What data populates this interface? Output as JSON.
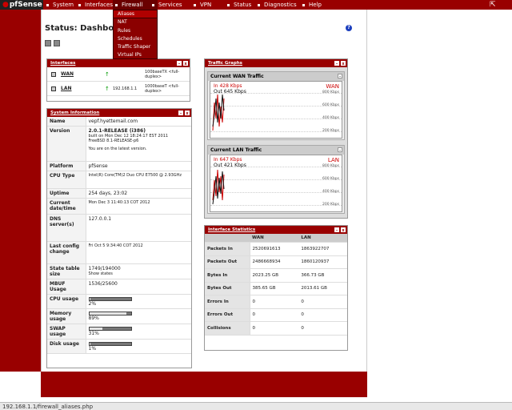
{
  "nav": {
    "logo": "pfSense",
    "items": [
      {
        "label": "System"
      },
      {
        "label": "Interfaces"
      },
      {
        "label": "Firewall"
      },
      {
        "label": "Services"
      },
      {
        "label": "VPN"
      },
      {
        "label": "Status"
      },
      {
        "label": "Diagnostics"
      },
      {
        "label": "Help"
      }
    ],
    "firewall_menu": [
      "Aliases",
      "NAT",
      "Rules",
      "Schedules",
      "Traffic Shaper",
      "Virtual IPs"
    ]
  },
  "page": {
    "title": "Status: Dashboard"
  },
  "interfaces": {
    "title": "Interfaces",
    "rows": [
      {
        "name": "WAN",
        "ip": "",
        "media": "100baseTX <full-duplex>"
      },
      {
        "name": "LAN",
        "ip": "192.168.1.1",
        "media": "1000baseT <full-duplex>"
      }
    ]
  },
  "sysinfo": {
    "title": "System Information",
    "name_label": "Name",
    "name": "vepf.hyettemail.com",
    "version_label": "Version",
    "version": "2.0.1-RELEASE (i386)",
    "version_built": "built on Mon Dec 12 18:24:17 EST 2011",
    "version_os": "FreeBSD 8.1-RELEASE-p6",
    "version_latest": "You are on the latest version.",
    "platform_label": "Platform",
    "platform": "pfSense",
    "cpu_type_label": "CPU Type",
    "cpu_type": "Intel(R) Core(TM)2 Duo CPU E7500 @ 2.93GHz",
    "uptime_label": "Uptime",
    "uptime": "254 days, 23:02",
    "datetime_label": "Current date/time",
    "datetime": "Mon Dec 3 11:40:13 COT 2012",
    "dns_label": "DNS server(s)",
    "dns": "127.0.0.1",
    "lastchange_label": "Last config change",
    "lastchange": "Fri Oct 5 9:34:40 COT 2012",
    "state_label": "State table size",
    "state": "1749/194000",
    "state_link": "Show states",
    "mbuf_label": "MBUF Usage",
    "mbuf": "1536/25600",
    "cpu_label": "CPU usage",
    "cpu": "2%",
    "cpu_pct": 2,
    "memory_label": "Memory usage",
    "memory": "89%",
    "memory_pct": 89,
    "swap_label": "SWAP usage",
    "swap": "31%",
    "swap_pct": 31,
    "disk_label": "Disk usage",
    "disk": "1%",
    "disk_pct": 1
  },
  "traffic": {
    "title": "Traffic Graphs",
    "wan": {
      "title": "Current WAN Traffic",
      "in": "In   428 Kbps",
      "out": "Out 645 Kbps",
      "tag": "WAN",
      "y": [
        "800 Kbps",
        "600 Kbps",
        "400 Kbps",
        "200 Kbps"
      ]
    },
    "lan": {
      "title": "Current LAN Traffic",
      "in": "In   647 Kbps",
      "out": "Out 421 Kbps",
      "tag": "LAN",
      "y": [
        "800 Kbps",
        "600 Kbps",
        "400 Kbps",
        "200 Kbps"
      ]
    }
  },
  "stats": {
    "title": "Interface Statistics",
    "cols": [
      "WAN",
      "LAN"
    ],
    "rows": [
      {
        "label": "Packets In",
        "wan": "2520691613",
        "lan": "1863922707"
      },
      {
        "label": "Packets Out",
        "wan": "2486668934",
        "lan": "1860120937"
      },
      {
        "label": "Bytes In",
        "wan": "2023.25 GB",
        "lan": "366.73 GB"
      },
      {
        "label": "Bytes Out",
        "wan": "385.65 GB",
        "lan": "2013.61 GB"
      },
      {
        "label": "Errors In",
        "wan": "0",
        "lan": "0"
      },
      {
        "label": "Errors Out",
        "wan": "0",
        "lan": "0"
      },
      {
        "label": "Collisions",
        "wan": "0",
        "lan": "0"
      }
    ]
  },
  "statusbar": {
    "url": "192.168.1.1/firewall_aliases.php"
  },
  "colors": {
    "brand": "#990000",
    "panel_header": "#990000"
  }
}
